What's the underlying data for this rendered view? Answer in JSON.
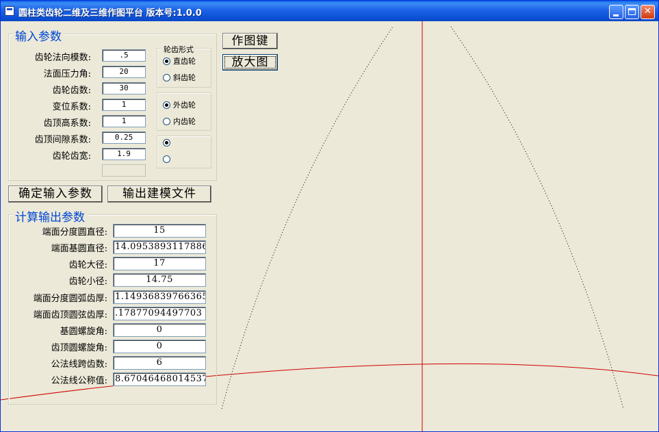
{
  "window": {
    "title": "圆柱类齿轮二维及三维作图平台 版本号:1.0.0"
  },
  "input_group": {
    "legend": "输入参数",
    "fields": [
      {
        "label": "齿轮法向模数:",
        "value": ".5"
      },
      {
        "label": "法面压力角:",
        "value": "20"
      },
      {
        "label": "齿轮齿数:",
        "value": "30"
      },
      {
        "label": "变位系数:",
        "value": "1"
      },
      {
        "label": "齿顶高系数:",
        "value": "1"
      },
      {
        "label": "齿顶间隙系数:",
        "value": "0.25"
      },
      {
        "label": "齿轮齿宽:",
        "value": "1.9"
      }
    ],
    "extra_field_value": ""
  },
  "gear_form": {
    "legend": "轮齿形式",
    "options": [
      {
        "label": "直齿轮",
        "checked": true
      },
      {
        "label": "斜齿轮",
        "checked": false
      }
    ]
  },
  "gear_type": {
    "options": [
      {
        "label": "外齿轮",
        "checked": true
      },
      {
        "label": "内齿轮",
        "checked": false
      }
    ]
  },
  "third_option": {
    "options": [
      {
        "label": "",
        "checked": true
      },
      {
        "label": "",
        "checked": false
      }
    ]
  },
  "buttons": {
    "draw": "作图键",
    "zoom": "放大图",
    "confirm": "确定输入参数",
    "export": "输出建模文件"
  },
  "output_group": {
    "legend": "计算输出参数",
    "fields": [
      {
        "label": "端面分度圆直径:",
        "value": "15"
      },
      {
        "label": "端面基圆直径:",
        "value": "14.0953893117886"
      },
      {
        "label": "齿轮大径:",
        "value": "17"
      },
      {
        "label": "齿轮小径:",
        "value": "14.75"
      },
      {
        "label": "端面分度圆弧齿厚:",
        "value": "1.14936839766365"
      },
      {
        "label": "端面齿顶圆弦齿厚:",
        "value": ".17877094497703"
      },
      {
        "label": "基圆螺旋角:",
        "value": "0"
      },
      {
        "label": "齿顶圆螺旋角:",
        "value": "0"
      },
      {
        "label": "公法线跨齿数:",
        "value": "6"
      },
      {
        "label": "公法线公称值:",
        "value": "8.67046468014537"
      }
    ]
  },
  "colors": {
    "titlebar": "#0a5fe8",
    "axis": "#d00000",
    "profile": "#000000",
    "background": "#ece9d8"
  }
}
